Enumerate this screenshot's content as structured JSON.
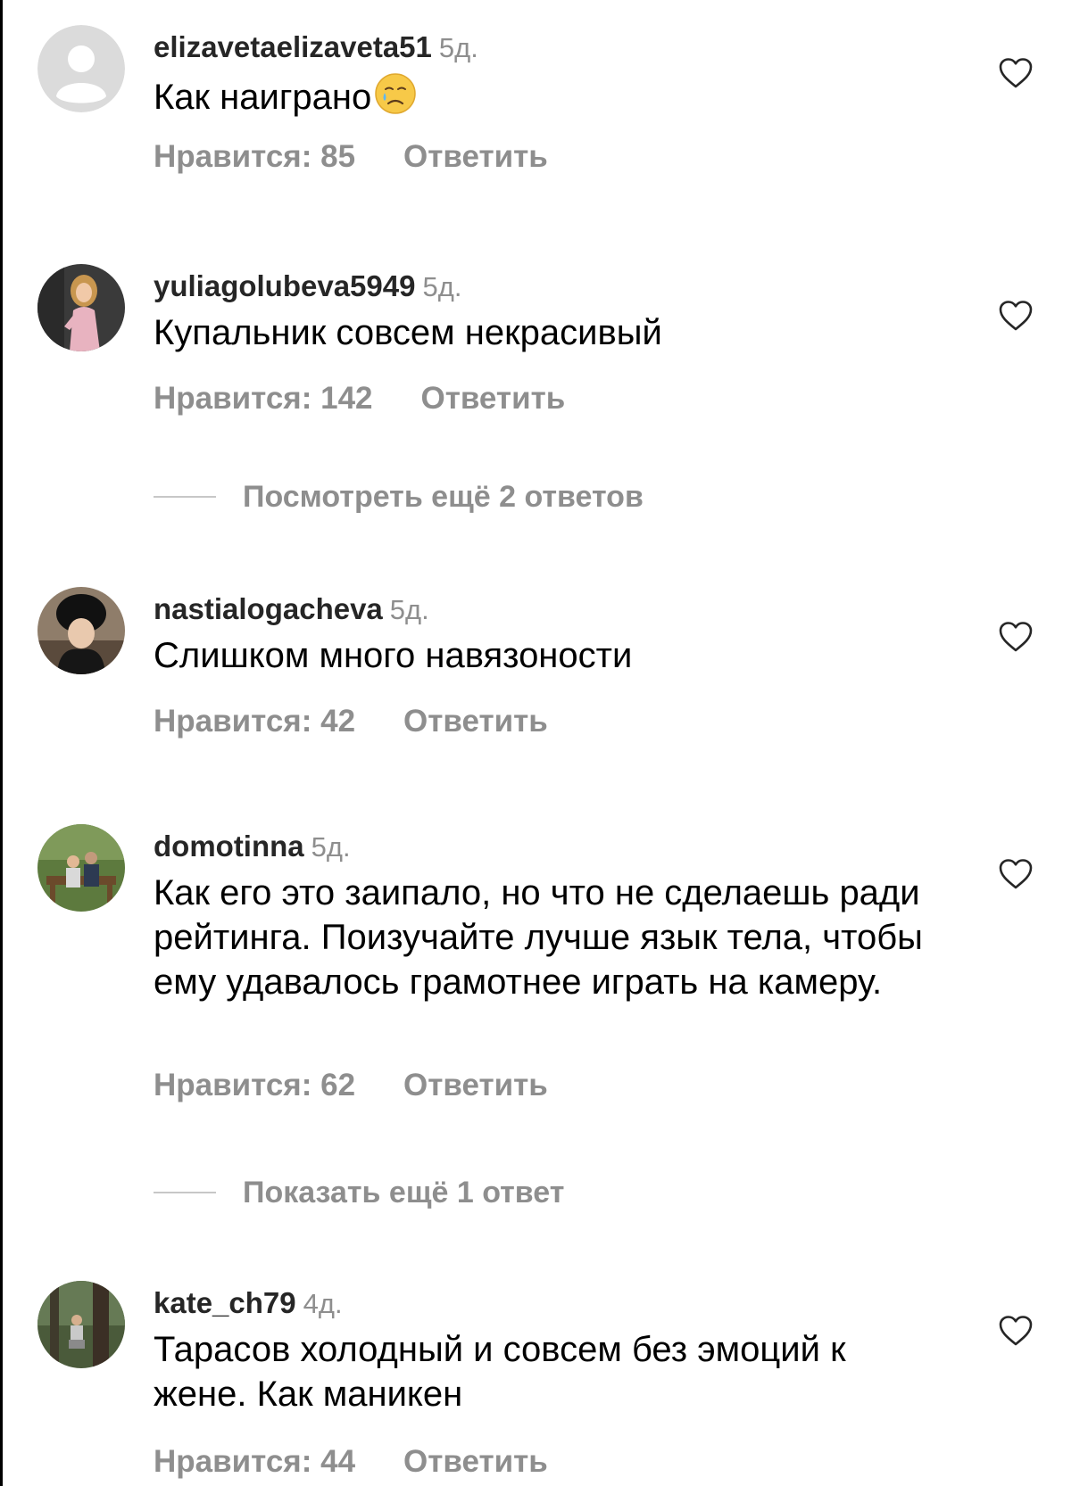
{
  "comments": [
    {
      "username": "elizavetaelizaveta51",
      "time": "5д.",
      "text": "Как наиграно",
      "emoji": "crying-face",
      "likes": "Нравится: 85",
      "reply": "Ответить",
      "avatar": "default-avatar"
    },
    {
      "username": "yuliagolubeva5949",
      "time": "5д.",
      "text": "Купальник совсем некрасивый",
      "likes": "Нравится: 142",
      "reply": "Ответить",
      "avatar": "photo-woman-pink-dress",
      "more_replies": "Посмотреть ещё 2 ответов"
    },
    {
      "username": "nastialogacheva",
      "time": "5д.",
      "text": "Слишком много навязоности",
      "likes": "Нравится: 42",
      "reply": "Ответить",
      "avatar": "photo-woman-dark-hat"
    },
    {
      "username": "domotinna",
      "time": "5д.",
      "text": "Как его это заипало,  но что не сделаешь ради рейтинга. Поизучайте лучше язык тела, чтобы ему удавалось грамотнее играть на камеру.",
      "likes": "Нравится: 62",
      "reply": "Ответить",
      "avatar": "photo-couple-bench",
      "more_replies": "Показать ещё 1 ответ"
    },
    {
      "username": "kate_ch79",
      "time": "4д.",
      "text": "Тарасов холодный и совсем без эмоций к жене. Как маникен",
      "likes": "Нравится: 44",
      "reply": "Ответить",
      "avatar": "photo-person-forest"
    }
  ],
  "icons": {
    "like": "heart-outline-icon"
  },
  "colors": {
    "username": "#262626",
    "secondary": "#8e8e8e",
    "text": "#000000",
    "divider": "#c7c7c7"
  }
}
